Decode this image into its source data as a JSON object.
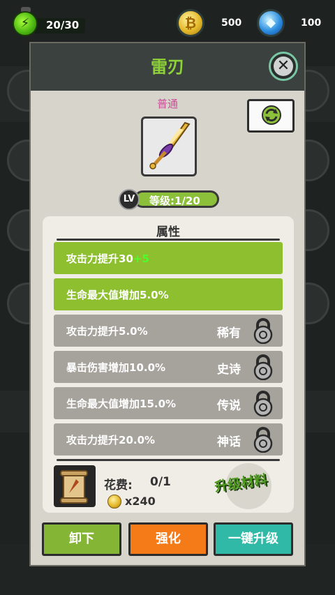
{
  "topbar": {
    "stamina_text": "20/30",
    "gold_amount": "500",
    "gem_amount": "100"
  },
  "dialog": {
    "title": "雷刃",
    "rarity_label": "普通",
    "level_badge": "LV",
    "level_text": "等级:1/20",
    "attributes_title": "属性",
    "attributes": [
      {
        "label": "攻击力提升30",
        "bonus": "+5",
        "rarity": "",
        "locked": false
      },
      {
        "label": "生命最大值增加5.0%",
        "bonus": "",
        "rarity": "",
        "locked": false
      },
      {
        "label": "攻击力提升5.0%",
        "bonus": "",
        "rarity": "稀有",
        "locked": true
      },
      {
        "label": "暴击伤害增加10.0%",
        "bonus": "",
        "rarity": "史诗",
        "locked": true
      },
      {
        "label": "生命最大值增加15.0%",
        "bonus": "",
        "rarity": "传说",
        "locked": true
      },
      {
        "label": "攻击力提升20.0%",
        "bonus": "",
        "rarity": "神话",
        "locked": true
      }
    ],
    "cost_label": "花费:",
    "cost_value": "0/1",
    "coin_cost": "x240",
    "upgrade_material_label": "升级材料",
    "buttons": {
      "unequip": "卸下",
      "enhance": "强化",
      "one_key_upgrade": "一键升级"
    }
  },
  "colors": {
    "title_green": "#8ed13a",
    "rarity_pink": "#d04a9a",
    "attr_active": "#8dbf2f",
    "attr_locked": "#a6a39d",
    "btn_unequip": "#85b535",
    "btn_enhance": "#f47b18",
    "btn_onekey": "#2fb9a6"
  },
  "icons": [
    "stamina-icon",
    "gold-coin-icon",
    "gem-icon",
    "close-icon",
    "refresh-icon",
    "sword-icon",
    "lock-icon",
    "scroll-icon"
  ]
}
